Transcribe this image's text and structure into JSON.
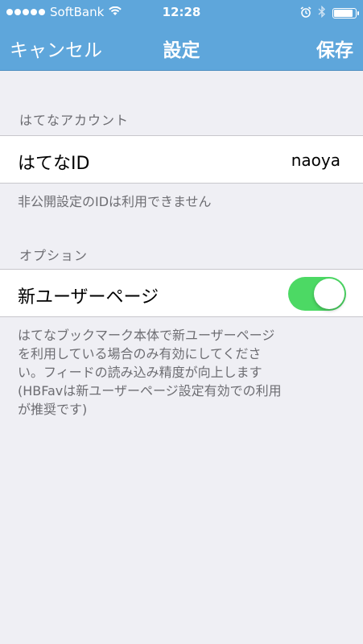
{
  "status_bar": {
    "carrier": "SoftBank",
    "time": "12:28"
  },
  "nav": {
    "cancel_label": "キャンセル",
    "title": "設定",
    "save_label": "保存"
  },
  "account_section": {
    "header": "はてなアカウント",
    "id_label": "はてなID",
    "id_value": "naoya",
    "footer": "非公開設定のIDは利用できません"
  },
  "options_section": {
    "header": "オプション",
    "new_user_page_label": "新ユーザーページ",
    "new_user_page_enabled": true,
    "footer_lines": [
      "はてなブックマーク本体で新ユーザーページ",
      "を利用している場合のみ有効にしてくださ",
      "い。フィードの読み込み精度が向上します",
      "(HBFavは新ユーザーページ設定有効での利用",
      "が推奨です)"
    ]
  },
  "colors": {
    "nav_background": "#5ea6db",
    "toggle_on": "#4cd964",
    "background": "#efeff4"
  }
}
